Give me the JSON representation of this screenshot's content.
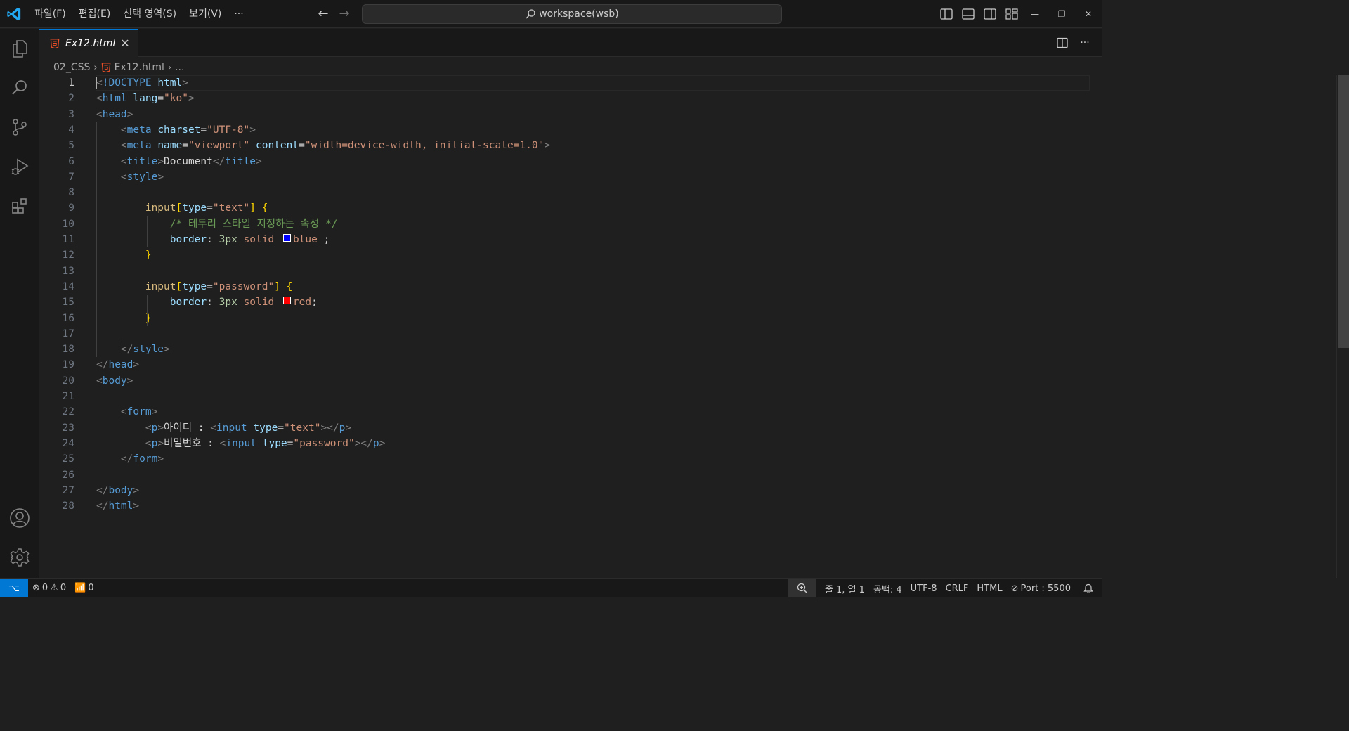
{
  "titlebar": {
    "menus": [
      "파일(F)",
      "편집(E)",
      "선택 영역(S)",
      "보기(V)",
      "···"
    ],
    "search": "workspace(wsb)",
    "accent": "#0078d4"
  },
  "activitybar": {
    "items": [
      "explorer-icon",
      "search-icon",
      "source-control-icon",
      "run-debug-icon",
      "extensions-icon"
    ],
    "bottom": [
      "account-icon",
      "manage-gear-icon"
    ]
  },
  "tab": {
    "label": "Ex12.html",
    "close": "✕"
  },
  "breadcrumbs": {
    "folder": "02_CSS",
    "file": "Ex12.html",
    "more": "..."
  },
  "editor": {
    "active_line": 1,
    "line_numbers": [
      "1",
      "2",
      "3",
      "4",
      "5",
      "6",
      "7",
      "8",
      "9",
      "10",
      "11",
      "12",
      "13",
      "14",
      "15",
      "16",
      "17",
      "18",
      "19",
      "20",
      "21",
      "22",
      "23",
      "24",
      "25",
      "26",
      "27",
      "28"
    ],
    "lines": [
      [
        [
          "punc",
          "<"
        ],
        [
          "tag",
          "!DOCTYPE"
        ],
        [
          "text",
          " "
        ],
        [
          "attr",
          "html"
        ],
        [
          "punc",
          ">"
        ]
      ],
      [
        [
          "punc",
          "<"
        ],
        [
          "tag",
          "html"
        ],
        [
          "text",
          " "
        ],
        [
          "attr",
          "lang"
        ],
        [
          "text",
          "="
        ],
        [
          "str",
          "\"ko\""
        ],
        [
          "punc",
          ">"
        ]
      ],
      [
        [
          "punc",
          "<"
        ],
        [
          "tag",
          "head"
        ],
        [
          "punc",
          ">"
        ]
      ],
      [
        [
          "text",
          "    "
        ],
        [
          "punc",
          "<"
        ],
        [
          "tag",
          "meta"
        ],
        [
          "text",
          " "
        ],
        [
          "attr",
          "charset"
        ],
        [
          "text",
          "="
        ],
        [
          "str",
          "\"UTF-8\""
        ],
        [
          "punc",
          ">"
        ]
      ],
      [
        [
          "text",
          "    "
        ],
        [
          "punc",
          "<"
        ],
        [
          "tag",
          "meta"
        ],
        [
          "text",
          " "
        ],
        [
          "attr",
          "name"
        ],
        [
          "text",
          "="
        ],
        [
          "str",
          "\"viewport\""
        ],
        [
          "text",
          " "
        ],
        [
          "attr",
          "content"
        ],
        [
          "text",
          "="
        ],
        [
          "str",
          "\"width=device-width, initial-scale=1.0\""
        ],
        [
          "punc",
          ">"
        ]
      ],
      [
        [
          "text",
          "    "
        ],
        [
          "punc",
          "<"
        ],
        [
          "tag",
          "title"
        ],
        [
          "punc",
          ">"
        ],
        [
          "text",
          "Document"
        ],
        [
          "punc",
          "</"
        ],
        [
          "tag",
          "title"
        ],
        [
          "punc",
          ">"
        ]
      ],
      [
        [
          "text",
          "    "
        ],
        [
          "punc",
          "<"
        ],
        [
          "tag",
          "style"
        ],
        [
          "punc",
          ">"
        ]
      ],
      [],
      [
        [
          "text",
          "        "
        ],
        [
          "sel",
          "input"
        ],
        [
          "brace",
          "["
        ],
        [
          "prop",
          "type"
        ],
        [
          "text",
          "="
        ],
        [
          "str",
          "\"text\""
        ],
        [
          "brace",
          "]"
        ],
        [
          "text",
          " "
        ],
        [
          "brace",
          "{"
        ]
      ],
      [
        [
          "text",
          "            "
        ],
        [
          "com",
          "/* 테두리 스타일 지정하는 속성 */"
        ]
      ],
      [
        [
          "text",
          "            "
        ],
        [
          "prop",
          "border"
        ],
        [
          "text",
          ": "
        ],
        [
          "num",
          "3px"
        ],
        [
          "text",
          " "
        ],
        [
          "val",
          "solid"
        ],
        [
          "text",
          " "
        ],
        [
          "swatch",
          "#0000ff"
        ],
        [
          "val",
          "blue"
        ],
        [
          "text",
          " ;"
        ]
      ],
      [
        [
          "text",
          "        "
        ],
        [
          "brace",
          "}"
        ]
      ],
      [],
      [
        [
          "text",
          "        "
        ],
        [
          "sel",
          "input"
        ],
        [
          "brace",
          "["
        ],
        [
          "prop",
          "type"
        ],
        [
          "text",
          "="
        ],
        [
          "str",
          "\"password\""
        ],
        [
          "brace",
          "]"
        ],
        [
          "text",
          " "
        ],
        [
          "brace",
          "{"
        ]
      ],
      [
        [
          "text",
          "            "
        ],
        [
          "prop",
          "border"
        ],
        [
          "text",
          ": "
        ],
        [
          "num",
          "3px"
        ],
        [
          "text",
          " "
        ],
        [
          "val",
          "solid"
        ],
        [
          "text",
          " "
        ],
        [
          "swatch",
          "#ff0000"
        ],
        [
          "val",
          "red"
        ],
        [
          "text",
          ";"
        ]
      ],
      [
        [
          "text",
          "        "
        ],
        [
          "brace",
          "}"
        ]
      ],
      [],
      [
        [
          "text",
          "    "
        ],
        [
          "punc",
          "</"
        ],
        [
          "tag",
          "style"
        ],
        [
          "punc",
          ">"
        ]
      ],
      [
        [
          "punc",
          "</"
        ],
        [
          "tag",
          "head"
        ],
        [
          "punc",
          ">"
        ]
      ],
      [
        [
          "punc",
          "<"
        ],
        [
          "tag",
          "body"
        ],
        [
          "punc",
          ">"
        ]
      ],
      [],
      [
        [
          "text",
          "    "
        ],
        [
          "punc",
          "<"
        ],
        [
          "tag",
          "form"
        ],
        [
          "punc",
          ">"
        ]
      ],
      [
        [
          "text",
          "        "
        ],
        [
          "punc",
          "<"
        ],
        [
          "tag",
          "p"
        ],
        [
          "punc",
          ">"
        ],
        [
          "text",
          "아이디 : "
        ],
        [
          "punc",
          "<"
        ],
        [
          "tag",
          "input"
        ],
        [
          "text",
          " "
        ],
        [
          "attr",
          "type"
        ],
        [
          "text",
          "="
        ],
        [
          "str",
          "\"text\""
        ],
        [
          "punc",
          "></"
        ],
        [
          "tag",
          "p"
        ],
        [
          "punc",
          ">"
        ]
      ],
      [
        [
          "text",
          "        "
        ],
        [
          "punc",
          "<"
        ],
        [
          "tag",
          "p"
        ],
        [
          "punc",
          ">"
        ],
        [
          "text",
          "비밀번호 : "
        ],
        [
          "punc",
          "<"
        ],
        [
          "tag",
          "input"
        ],
        [
          "text",
          " "
        ],
        [
          "attr",
          "type"
        ],
        [
          "text",
          "="
        ],
        [
          "str",
          "\"password\""
        ],
        [
          "punc",
          "></"
        ],
        [
          "tag",
          "p"
        ],
        [
          "punc",
          ">"
        ]
      ],
      [
        [
          "text",
          "    "
        ],
        [
          "punc",
          "</"
        ],
        [
          "tag",
          "form"
        ],
        [
          "punc",
          ">"
        ]
      ],
      [],
      [
        [
          "punc",
          "</"
        ],
        [
          "tag",
          "body"
        ],
        [
          "punc",
          ">"
        ]
      ],
      [
        [
          "punc",
          "</"
        ],
        [
          "tag",
          "html"
        ],
        [
          "punc",
          ">"
        ]
      ]
    ]
  },
  "statusbar": {
    "remote": "⌥",
    "errors": "0",
    "warnings": "0",
    "ports": "0",
    "position": "줄 1, 열 1",
    "indent": "공백: 4",
    "encoding": "UTF-8",
    "eol": "CRLF",
    "language": "HTML",
    "port": "Port : 5500"
  }
}
